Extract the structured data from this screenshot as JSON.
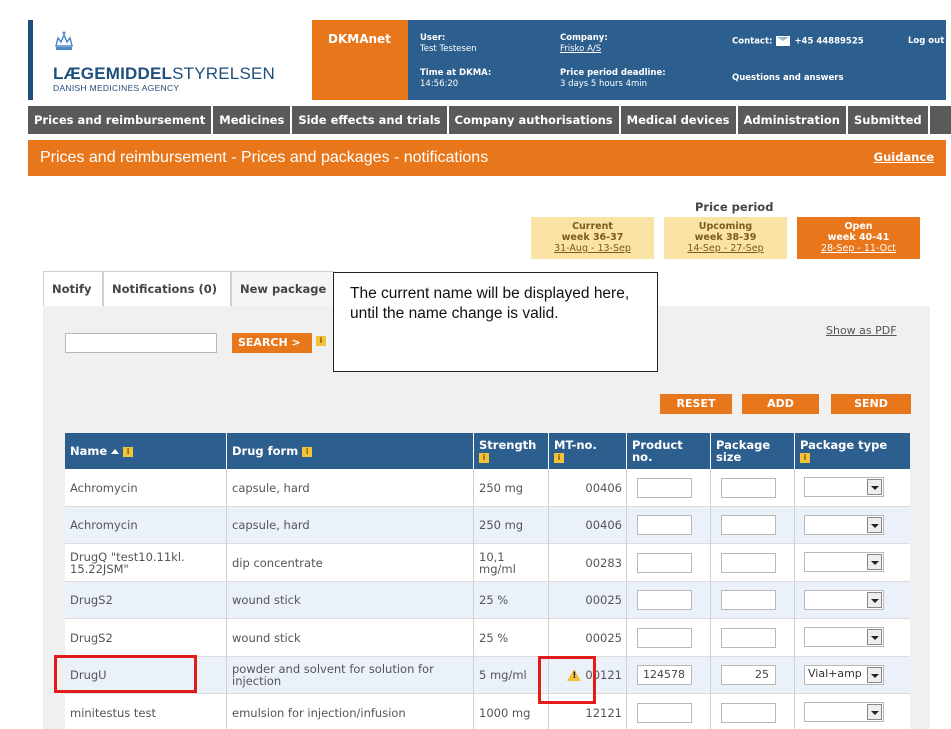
{
  "header": {
    "logo_title_bold": "LÆGEMIDDEL",
    "logo_title_thin": "STYRELSEN",
    "logo_sub": "DANISH MEDICINES AGENCY",
    "app_name": "DKMAnet",
    "user_label": "User:",
    "user_value": "Test Testesen",
    "time_label": "Time at DKMA:",
    "time_value": "14:56:20",
    "company_label": "Company:",
    "company_value": "Frisko A/S",
    "deadline_label": "Price period deadline:",
    "deadline_value": "3 days 5 hours 4min",
    "contact_label": "Contact:",
    "contact_phone": "+45 44889525",
    "logout": "Log out",
    "qa": "Questions and answers"
  },
  "nav": [
    "Prices and reimbursement",
    "Medicines",
    "Side effects and trials",
    "Company authorisations",
    "Medical devices",
    "Administration",
    "Submitted"
  ],
  "page": {
    "title": "Prices and reimbursement - Prices and packages - notifications",
    "guidance": "Guidance"
  },
  "price_period": {
    "label": "Price period",
    "current": {
      "name": "Current",
      "week": "week 36-37",
      "dates": "31-Aug - 13-Sep"
    },
    "upcoming": {
      "name": "Upcoming",
      "week": "week 38-39",
      "dates": "14-Sep - 27-Sep"
    },
    "open": {
      "name": "Open",
      "week": "week 40-41",
      "dates": "28-Sep - 11-Oct"
    }
  },
  "tabs": [
    "Notify",
    "Notifications (0)",
    "New package"
  ],
  "search": {
    "button": "SEARCH >",
    "value": ""
  },
  "show_pdf": "Show as PDF",
  "actions": {
    "reset": "RESET",
    "add": "ADD",
    "send": "SEND"
  },
  "callout": "The current name will be displayed here, until the name change is valid.",
  "table": {
    "headers": [
      "Name",
      "Drug form",
      "Strength",
      "MT-no.",
      "Product no.",
      "Package size",
      "Package type"
    ],
    "rows": [
      {
        "name": "Achromycin",
        "form": "capsule, hard",
        "strength": "250 mg",
        "mt": "00406",
        "product": "",
        "size": "",
        "type": "",
        "warn": false
      },
      {
        "name": "Achromycin",
        "form": "capsule, hard",
        "strength": "250 mg",
        "mt": "00406",
        "product": "",
        "size": "",
        "type": "",
        "warn": false
      },
      {
        "name": "DrugQ \"test10.11kl. 15.22JSM\"",
        "form": "dip concentrate",
        "strength": "10,1 mg/ml",
        "mt": "00283",
        "product": "",
        "size": "",
        "type": "",
        "warn": false
      },
      {
        "name": "DrugS2",
        "form": "wound stick",
        "strength": "25 %",
        "mt": "00025",
        "product": "",
        "size": "",
        "type": "",
        "warn": false
      },
      {
        "name": "DrugS2",
        "form": "wound stick",
        "strength": "25 %",
        "mt": "00025",
        "product": "",
        "size": "",
        "type": "",
        "warn": false
      },
      {
        "name": "DrugU",
        "form": "powder and solvent for solution for injection",
        "strength": "5 mg/ml",
        "mt": "00121",
        "product": "124578",
        "size": "25",
        "type": "Vial+amp",
        "warn": true
      },
      {
        "name": "minitestus test",
        "form": "emulsion for injection/infusion",
        "strength": "1000 mg",
        "mt": "12121",
        "product": "",
        "size": "",
        "type": "",
        "warn": false
      }
    ]
  },
  "colors": {
    "orange": "#e8761b",
    "blue": "#2d5f8e",
    "nav_gray": "#5a5a5a",
    "highlight_red": "#e21b1b"
  }
}
